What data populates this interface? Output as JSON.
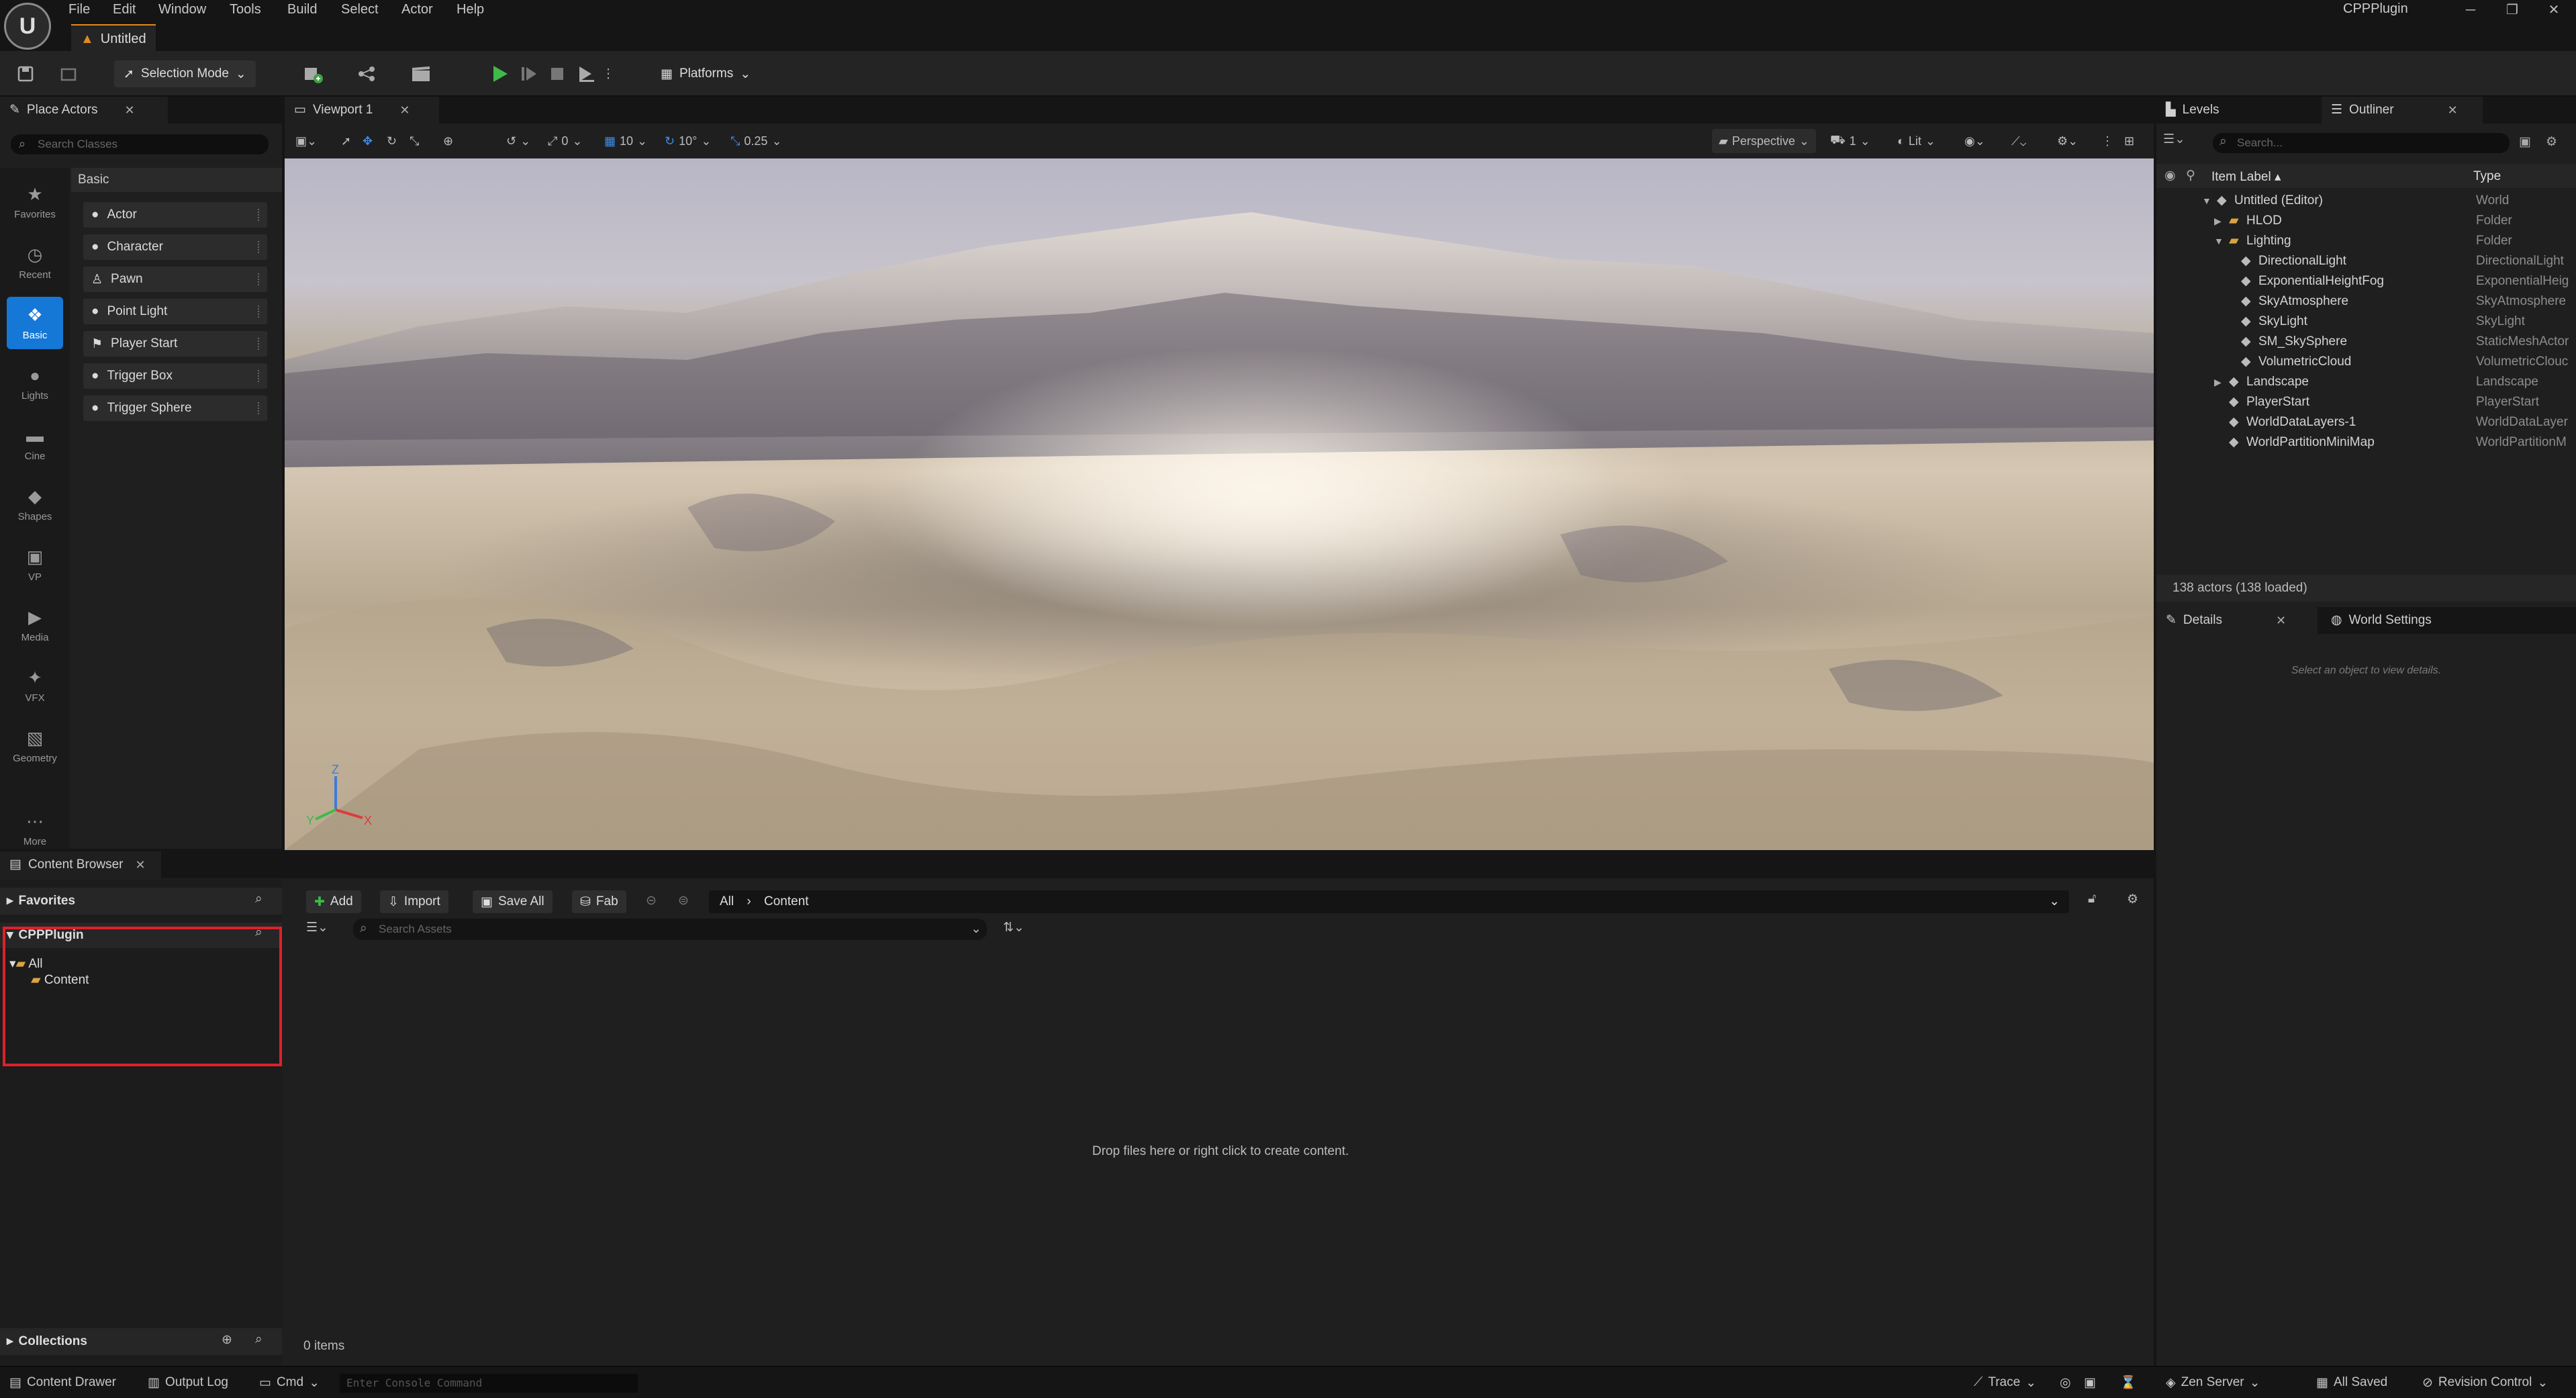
{
  "menu": {
    "items": [
      "File",
      "Edit",
      "Window",
      "Tools",
      "Build",
      "Select",
      "Actor",
      "Help"
    ],
    "document_tab": "Untitled",
    "app_name": "CPPPlugin"
  },
  "toolbar": {
    "selection_mode": "Selection Mode",
    "platforms": "Platforms"
  },
  "place_actors": {
    "tab_label": "Place Actors",
    "search_placeholder": "Search Classes",
    "categories": [
      "Favorites",
      "Recent",
      "Basic",
      "Lights",
      "Cine",
      "Shapes",
      "VP",
      "Media",
      "VFX",
      "Geometry",
      "More"
    ],
    "active_category": "Basic",
    "section_header": "Basic",
    "actors": [
      "Actor",
      "Character",
      "Pawn",
      "Point Light",
      "Player Start",
      "Trigger Box",
      "Trigger Sphere"
    ]
  },
  "viewport": {
    "tab_label": "Viewport 1",
    "rotation_snap": "0",
    "grid_snap": "10",
    "angle_snap": "10°",
    "scale_snap": "0.25",
    "view_mode": "Perspective",
    "lighting": "Lit",
    "camera_speed": "1",
    "axes": {
      "z": "Z",
      "x": "X",
      "y": "Y"
    }
  },
  "outliner": {
    "levels_tab": "Levels",
    "outliner_tab": "Outliner",
    "search_placeholder": "Search...",
    "col_label": "Item Label",
    "col_type": "Type",
    "rows": [
      {
        "label": "Untitled (Editor)",
        "type": "World",
        "indent": 0,
        "arrow": "▼"
      },
      {
        "label": "HLOD",
        "type": "Folder",
        "indent": 1,
        "arrow": "▶"
      },
      {
        "label": "Lighting",
        "type": "Folder",
        "indent": 1,
        "arrow": "▼"
      },
      {
        "label": "DirectionalLight",
        "type": "DirectionalLight",
        "indent": 2,
        "arrow": ""
      },
      {
        "label": "ExponentialHeightFog",
        "type": "ExponentialHeig",
        "indent": 2,
        "arrow": ""
      },
      {
        "label": "SkyAtmosphere",
        "type": "SkyAtmosphere",
        "indent": 2,
        "arrow": ""
      },
      {
        "label": "SkyLight",
        "type": "SkyLight",
        "indent": 2,
        "arrow": ""
      },
      {
        "label": "SM_SkySphere",
        "type": "StaticMeshActor",
        "indent": 2,
        "arrow": ""
      },
      {
        "label": "VolumetricCloud",
        "type": "VolumetricClouc",
        "indent": 2,
        "arrow": ""
      },
      {
        "label": "Landscape",
        "type": "Landscape",
        "indent": 1,
        "arrow": "▶"
      },
      {
        "label": "PlayerStart",
        "type": "PlayerStart",
        "indent": 1,
        "arrow": ""
      },
      {
        "label": "WorldDataLayers-1",
        "type": "WorldDataLayer",
        "indent": 1,
        "arrow": ""
      },
      {
        "label": "WorldPartitionMiniMap",
        "type": "WorldPartitionM",
        "indent": 1,
        "arrow": ""
      }
    ],
    "actor_count": "138 actors (138 loaded)"
  },
  "details": {
    "details_tab": "Details",
    "world_settings_tab": "World Settings",
    "empty_hint": "Select an object to view details."
  },
  "content_browser": {
    "tab_label": "Content Browser",
    "favorites": "Favorites",
    "root": "CPPPlugin",
    "tree": [
      "All",
      "Content"
    ],
    "collections": "Collections",
    "add": "Add",
    "import": "Import",
    "save_all": "Save All",
    "fab": "Fab",
    "path": [
      "All",
      "Content"
    ],
    "search_placeholder": "Search Assets",
    "drop_hint": "Drop files here or right click to create content.",
    "item_count": "0 items"
  },
  "statusbar": {
    "content_drawer": "Content Drawer",
    "output_log": "Output Log",
    "cmd": "Cmd",
    "console_placeholder": "Enter Console Command",
    "trace": "Trace",
    "zen_server": "Zen Server",
    "all_saved": "All Saved",
    "revision_control": "Revision Control"
  }
}
